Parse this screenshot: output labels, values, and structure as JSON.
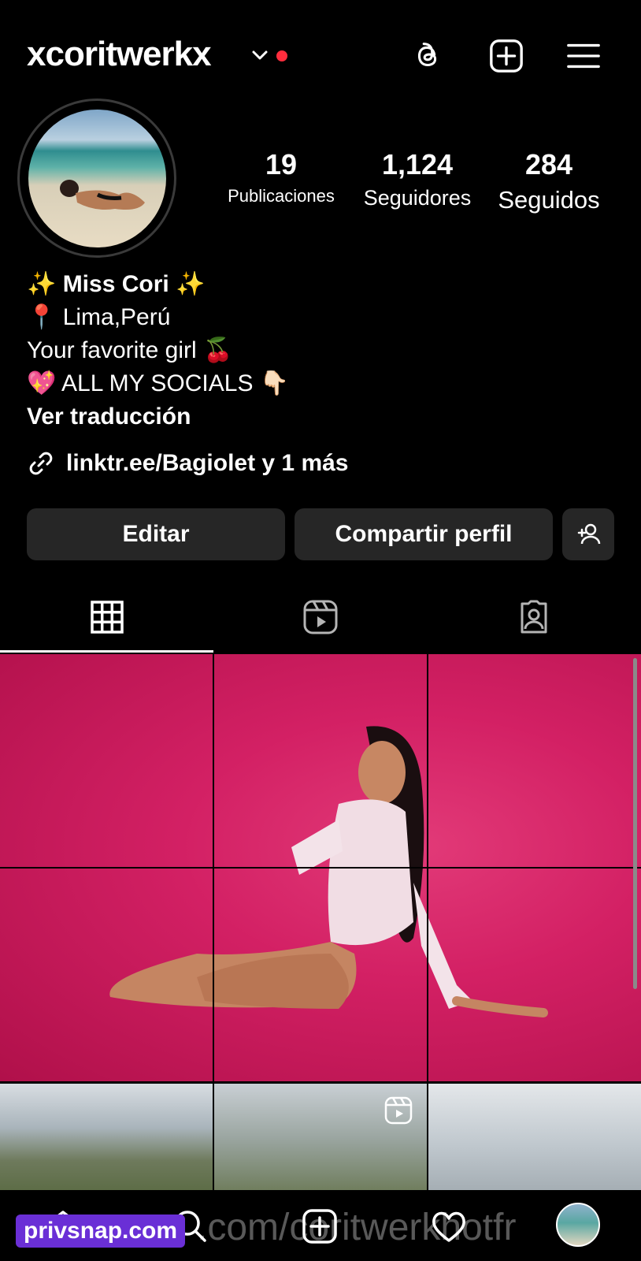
{
  "header": {
    "username": "xcoritwerkx",
    "icons": [
      "threads-icon",
      "create-post-icon",
      "menu-icon"
    ]
  },
  "stats": [
    {
      "value": "19",
      "label": "Publicaciones"
    },
    {
      "value": "1,124",
      "label": "Seguidores"
    },
    {
      "value": "284",
      "label": "Seguidos"
    }
  ],
  "bio": {
    "name": "✨ Miss Cori ✨",
    "line1": "📍 Lima,Perú",
    "line2": "Your favorite girl 🍒",
    "line3": "💖 ALL MY SOCIALS 👇🏻",
    "translate": "Ver traducción",
    "link": "linktr.ee/Bagiolet y 1 más"
  },
  "buttons": {
    "edit": "Editar",
    "share": "Compartir perfil"
  },
  "tabs": [
    "grid-icon",
    "reels-icon",
    "tagged-icon"
  ],
  "watermark": {
    "brand": "privsnap.com",
    "ghost": ".com/coritwerkhotfr"
  },
  "colors": {
    "background": "#000000",
    "button": "#262626",
    "notification": "#ff2d3d",
    "watermark": "#6a2fd6"
  }
}
